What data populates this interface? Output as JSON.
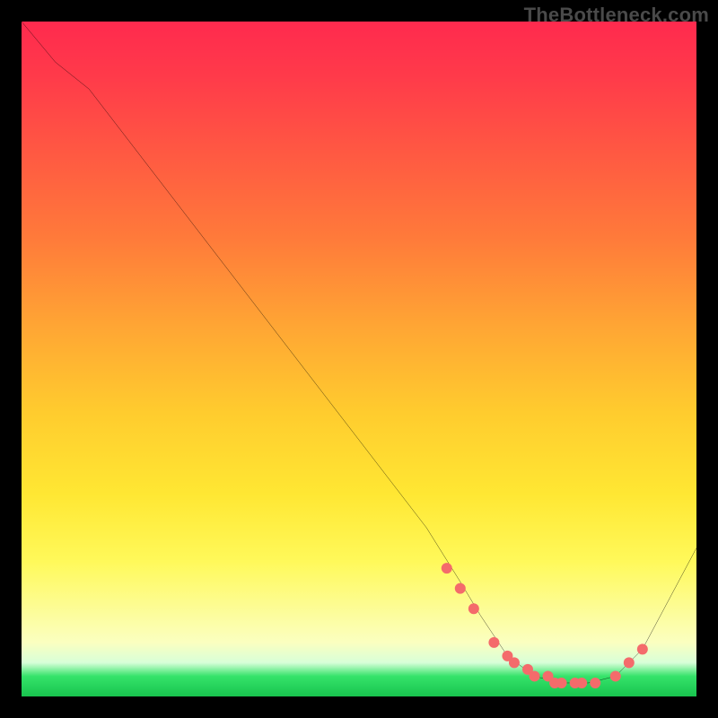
{
  "watermark": "TheBottleneck.com",
  "chart_data": {
    "type": "line",
    "title": "",
    "xlabel": "",
    "ylabel": "",
    "xlim": [
      0,
      100
    ],
    "ylim": [
      0,
      100
    ],
    "grid": false,
    "legend": false,
    "background_gradient": {
      "direction": "vertical",
      "stops": [
        {
          "pos": 0.0,
          "color": "#ff2a4e"
        },
        {
          "pos": 0.2,
          "color": "#ff5a42"
        },
        {
          "pos": 0.45,
          "color": "#ffa534"
        },
        {
          "pos": 0.7,
          "color": "#ffe733"
        },
        {
          "pos": 0.92,
          "color": "#fbffc0"
        },
        {
          "pos": 0.97,
          "color": "#35e36a"
        },
        {
          "pos": 1.0,
          "color": "#18c44e"
        }
      ]
    },
    "series": [
      {
        "name": "curve",
        "color": "#000000",
        "stroke_width": 2,
        "x": [
          0,
          5,
          10,
          20,
          30,
          40,
          50,
          60,
          65,
          68,
          72,
          76,
          80,
          84,
          88,
          92,
          100
        ],
        "y": [
          100,
          94,
          90,
          77,
          64,
          51,
          38,
          25,
          17,
          12,
          6,
          3,
          2,
          2,
          3,
          7,
          22
        ]
      }
    ],
    "markers": {
      "name": "dots",
      "color": "#f46b6b",
      "radius": 6,
      "x": [
        63,
        65,
        67,
        70,
        72,
        73,
        75,
        76,
        78,
        79,
        80,
        82,
        83,
        85,
        88,
        90,
        92
      ],
      "y": [
        19,
        16,
        13,
        8,
        6,
        5,
        4,
        3,
        3,
        2,
        2,
        2,
        2,
        2,
        3,
        5,
        7
      ]
    }
  }
}
